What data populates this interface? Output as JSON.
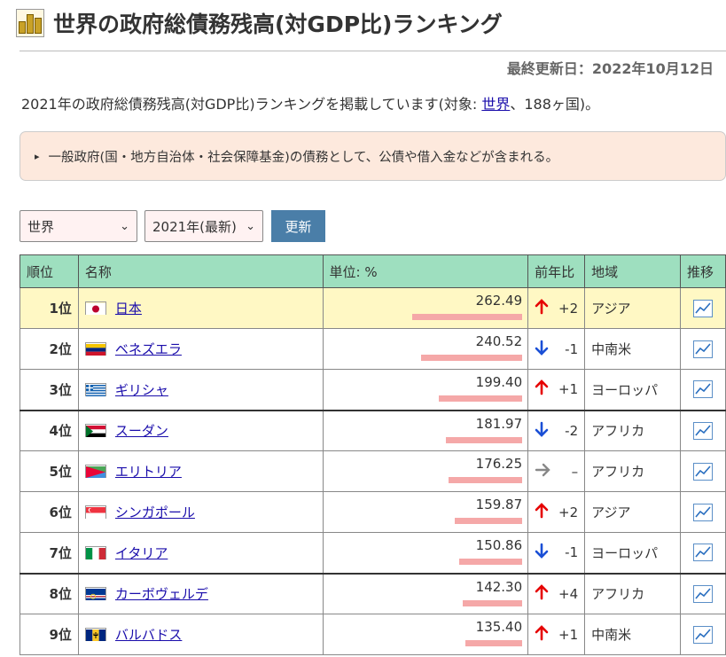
{
  "title": "世界の政府総債務残高(対GDP比)ランキング",
  "updated": "最終更新日：2022年10月12日",
  "description": {
    "before": "2021年の政府総債務残高(対GDP比)ランキングを掲載しています(対象: ",
    "link": "世界",
    "after": "、188ヶ国)。"
  },
  "note": "一般政府(国・地方自治体・社会保障基金)の債務として、公債や借入金などが含まれる。",
  "controls": {
    "region": "世界",
    "year": "2021年(最新)",
    "update": "更新"
  },
  "columns": {
    "rank": "順位",
    "name": "名称",
    "unit": "単位: %",
    "change": "前年比",
    "region": "地域",
    "trend": "推移"
  },
  "rows": [
    {
      "rank": "1位",
      "name": "日本",
      "value": "262.49",
      "dir": "up",
      "change": "+2",
      "region": "アジア",
      "flag": "japan"
    },
    {
      "rank": "2位",
      "name": "ベネズエラ",
      "value": "240.52",
      "dir": "down",
      "change": "-1",
      "region": "中南米",
      "flag": "venezuela"
    },
    {
      "rank": "3位",
      "name": "ギリシャ",
      "value": "199.40",
      "dir": "up",
      "change": "+1",
      "region": "ヨーロッパ",
      "flag": "greece"
    },
    {
      "rank": "4位",
      "name": "スーダン",
      "value": "181.97",
      "dir": "down",
      "change": "-2",
      "region": "アフリカ",
      "flag": "sudan"
    },
    {
      "rank": "5位",
      "name": "エリトリア",
      "value": "176.25",
      "dir": "flat",
      "change": "–",
      "region": "アフリカ",
      "flag": "eritrea"
    },
    {
      "rank": "6位",
      "name": "シンガポール",
      "value": "159.87",
      "dir": "up",
      "change": "+2",
      "region": "アジア",
      "flag": "singapore"
    },
    {
      "rank": "7位",
      "name": "イタリア",
      "value": "150.86",
      "dir": "down",
      "change": "-1",
      "region": "ヨーロッパ",
      "flag": "italy"
    },
    {
      "rank": "8位",
      "name": "カーボヴェルデ",
      "value": "142.30",
      "dir": "up",
      "change": "+4",
      "region": "アフリカ",
      "flag": "cabo-verde"
    },
    {
      "rank": "9位",
      "name": "バルバドス",
      "value": "135.40",
      "dir": "up",
      "change": "+1",
      "region": "中南米",
      "flag": "barbados"
    }
  ],
  "colors": {
    "header_bg": "#9edfbf",
    "highlight_row": "#fff8c4",
    "bar": "#f5a8a8",
    "up": "#e60000",
    "down": "#1a4fd6",
    "button": "#4a7ea8"
  }
}
